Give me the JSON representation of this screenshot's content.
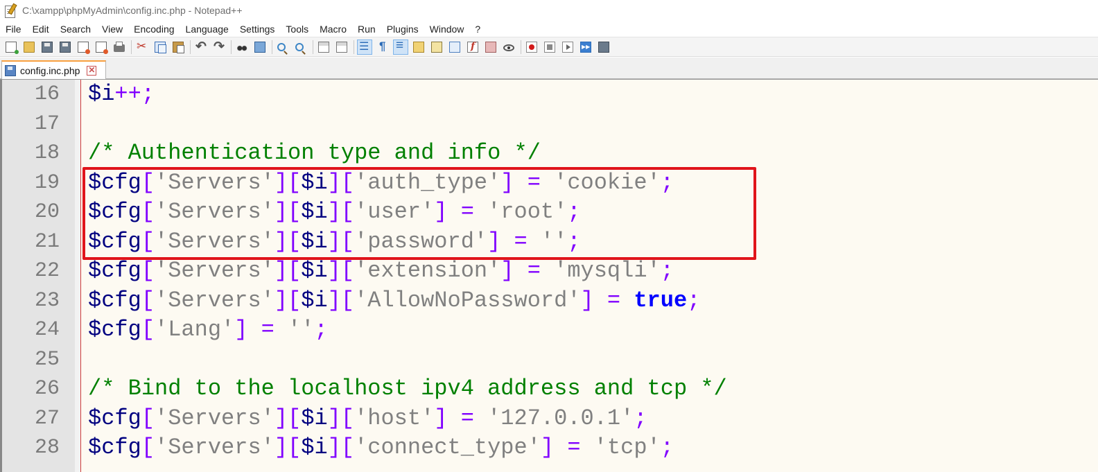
{
  "window": {
    "title": "C:\\xampp\\phpMyAdmin\\config.inc.php - Notepad++"
  },
  "menu": [
    "File",
    "Edit",
    "Search",
    "View",
    "Encoding",
    "Language",
    "Settings",
    "Tools",
    "Macro",
    "Run",
    "Plugins",
    "Window",
    "?"
  ],
  "toolbar": {
    "icons": [
      "new-file-icon",
      "open-file-icon",
      "save-icon",
      "save-all-icon",
      "close-icon",
      "close-all-icon",
      "print-icon",
      "cut-icon",
      "copy-icon",
      "paste-icon",
      "undo-icon",
      "redo-icon",
      "find-icon",
      "replace-icon",
      "zoom-in-icon",
      "zoom-out-icon",
      "sync-vertical-icon",
      "sync-horizontal-icon",
      "word-wrap-icon",
      "show-all-chars-icon",
      "indent-guide-icon",
      "user-language-icon",
      "document-map-icon",
      "document-list-icon",
      "function-list-icon",
      "folder-as-workspace-icon",
      "monitoring-icon",
      "record-macro-icon",
      "stop-recording-icon",
      "playback-macro-icon",
      "run-macro-multiple-icon",
      "save-macro-icon"
    ]
  },
  "tabs": [
    {
      "label": "config.inc.php",
      "close": "✕"
    }
  ],
  "editor": {
    "lines": [
      {
        "number": "16",
        "tokens": [
          [
            "var",
            "$i"
          ],
          [
            "op",
            "++;"
          ]
        ]
      },
      {
        "number": "17",
        "tokens": []
      },
      {
        "number": "18",
        "tokens": [
          [
            "com",
            "/* Authentication type and info */"
          ]
        ]
      },
      {
        "number": "19",
        "tokens": [
          [
            "var",
            "$cfg"
          ],
          [
            "op",
            "["
          ],
          [
            "str",
            "'Servers'"
          ],
          [
            "op",
            "]["
          ],
          [
            "var",
            "$i"
          ],
          [
            "op",
            "]["
          ],
          [
            "str",
            "'auth_type'"
          ],
          [
            "op",
            "] = "
          ],
          [
            "str",
            "'cookie'"
          ],
          [
            "op",
            ";"
          ]
        ]
      },
      {
        "number": "20",
        "tokens": [
          [
            "var",
            "$cfg"
          ],
          [
            "op",
            "["
          ],
          [
            "str",
            "'Servers'"
          ],
          [
            "op",
            "]["
          ],
          [
            "var",
            "$i"
          ],
          [
            "op",
            "]["
          ],
          [
            "str",
            "'user'"
          ],
          [
            "op",
            "] = "
          ],
          [
            "str",
            "'root'"
          ],
          [
            "op",
            ";"
          ]
        ]
      },
      {
        "number": "21",
        "tokens": [
          [
            "var",
            "$cfg"
          ],
          [
            "op",
            "["
          ],
          [
            "str",
            "'Servers'"
          ],
          [
            "op",
            "]["
          ],
          [
            "var",
            "$i"
          ],
          [
            "op",
            "]["
          ],
          [
            "str",
            "'password'"
          ],
          [
            "op",
            "] = "
          ],
          [
            "str",
            "''"
          ],
          [
            "op",
            ";"
          ]
        ]
      },
      {
        "number": "22",
        "tokens": [
          [
            "var",
            "$cfg"
          ],
          [
            "op",
            "["
          ],
          [
            "str",
            "'Servers'"
          ],
          [
            "op",
            "]["
          ],
          [
            "var",
            "$i"
          ],
          [
            "op",
            "]["
          ],
          [
            "str",
            "'extension'"
          ],
          [
            "op",
            "] = "
          ],
          [
            "str",
            "'mysqli'"
          ],
          [
            "op",
            ";"
          ]
        ]
      },
      {
        "number": "23",
        "tokens": [
          [
            "var",
            "$cfg"
          ],
          [
            "op",
            "["
          ],
          [
            "str",
            "'Servers'"
          ],
          [
            "op",
            "]["
          ],
          [
            "var",
            "$i"
          ],
          [
            "op",
            "]["
          ],
          [
            "str",
            "'AllowNoPassword'"
          ],
          [
            "op",
            "] = "
          ],
          [
            "kw",
            "true"
          ],
          [
            "op",
            ";"
          ]
        ]
      },
      {
        "number": "24",
        "tokens": [
          [
            "var",
            "$cfg"
          ],
          [
            "op",
            "["
          ],
          [
            "str",
            "'Lang'"
          ],
          [
            "op",
            "] = "
          ],
          [
            "str",
            "''"
          ],
          [
            "op",
            ";"
          ]
        ]
      },
      {
        "number": "25",
        "tokens": []
      },
      {
        "number": "26",
        "tokens": [
          [
            "com",
            "/* Bind to the localhost ipv4 address and tcp */"
          ]
        ]
      },
      {
        "number": "27",
        "tokens": [
          [
            "var",
            "$cfg"
          ],
          [
            "op",
            "["
          ],
          [
            "str",
            "'Servers'"
          ],
          [
            "op",
            "]["
          ],
          [
            "var",
            "$i"
          ],
          [
            "op",
            "]["
          ],
          [
            "str",
            "'host'"
          ],
          [
            "op",
            "] = "
          ],
          [
            "str",
            "'127.0.0.1'"
          ],
          [
            "op",
            ";"
          ]
        ]
      },
      {
        "number": "28",
        "tokens": [
          [
            "var",
            "$cfg"
          ],
          [
            "op",
            "["
          ],
          [
            "str",
            "'Servers'"
          ],
          [
            "op",
            "]["
          ],
          [
            "var",
            "$i"
          ],
          [
            "op",
            "]["
          ],
          [
            "str",
            "'connect_type'"
          ],
          [
            "op",
            "] = "
          ],
          [
            "str",
            "'tcp'"
          ],
          [
            "op",
            ";"
          ]
        ]
      }
    ],
    "highlight": {
      "from_line": "19",
      "to_line": "21",
      "color": "#e0141b"
    }
  },
  "colors": {
    "variable": "#000080",
    "operator": "#8000ff",
    "string": "#808080",
    "keyword": "#0000ff",
    "comment": "#008000",
    "editor_background": "#fdfaf2",
    "tab_accent": "#f9a03f"
  }
}
